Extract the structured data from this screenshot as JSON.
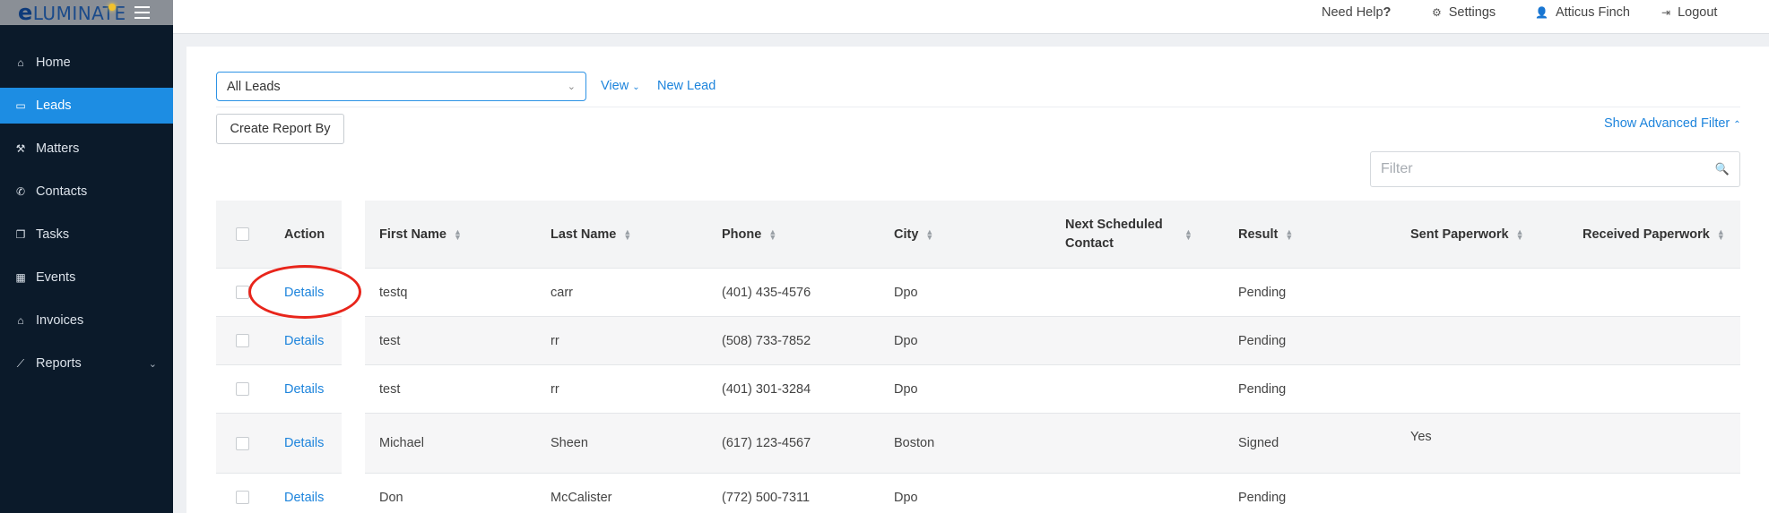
{
  "app": {
    "logo_prefix": "e",
    "logo_rest": "LUMINATE"
  },
  "sidebar": {
    "items": [
      {
        "label": "Home",
        "icon": "home-icon",
        "glyph": "⌂"
      },
      {
        "label": "Leads",
        "icon": "laptop-icon",
        "glyph": "▭",
        "active": true
      },
      {
        "label": "Matters",
        "icon": "gavel-icon",
        "glyph": "⚒"
      },
      {
        "label": "Contacts",
        "icon": "phone-icon",
        "glyph": "✆"
      },
      {
        "label": "Tasks",
        "icon": "copy-icon",
        "glyph": "❐"
      },
      {
        "label": "Events",
        "icon": "calendar-icon",
        "glyph": "▦"
      },
      {
        "label": "Invoices",
        "icon": "bank-icon",
        "glyph": "⌂"
      },
      {
        "label": "Reports",
        "icon": "line-chart-icon",
        "glyph": "⟋"
      }
    ]
  },
  "topbar": {
    "help": "Need Help",
    "help_mark": "?",
    "settings": "Settings",
    "user": "Atticus Finch",
    "logout": "Logout"
  },
  "toolbar": {
    "selected_list": "All Leads",
    "view_label": "View",
    "new_lead_label": "New Lead",
    "create_report_label": "Create Report By",
    "advanced_filter_label": "Show Advanced Filter",
    "filter_placeholder": "Filter"
  },
  "table": {
    "action_header": "Action",
    "columns": [
      "First Name",
      "Last Name",
      "Phone",
      "City",
      "Next Scheduled Contact",
      "Result",
      "Sent Paperwork",
      "Received Paperwork"
    ],
    "rows": [
      {
        "action": "Details",
        "first": "testq",
        "last": "carr",
        "phone": "(401) 435-4576",
        "city": "Dpo",
        "next": "",
        "result": "Pending",
        "sent": "",
        "received": ""
      },
      {
        "action": "Details",
        "first": "test",
        "last": "rr",
        "phone": "(508) 733-7852",
        "city": "Dpo",
        "next": "",
        "result": "Pending",
        "sent": "",
        "received": ""
      },
      {
        "action": "Details",
        "first": "test",
        "last": "rr",
        "phone": "(401) 301-3284",
        "city": "Dpo",
        "next": "",
        "result": "Pending",
        "sent": "",
        "received": ""
      },
      {
        "action": "Details",
        "first": "Michael",
        "last": "Sheen",
        "phone": "(617) 123-4567",
        "city": "Boston",
        "next": "",
        "result": "Signed",
        "sent": "Yes",
        "received": ""
      },
      {
        "action": "Details",
        "first": "Don",
        "last": "McCalister",
        "phone": "(772) 500-7311",
        "city": "Dpo",
        "next": "",
        "result": "Pending",
        "sent": "",
        "received": ""
      }
    ]
  },
  "colors": {
    "accent": "#1d8de3",
    "sidebar_bg": "#0b1a2a",
    "link": "#1d84dc",
    "annotation": "#e8251b"
  }
}
